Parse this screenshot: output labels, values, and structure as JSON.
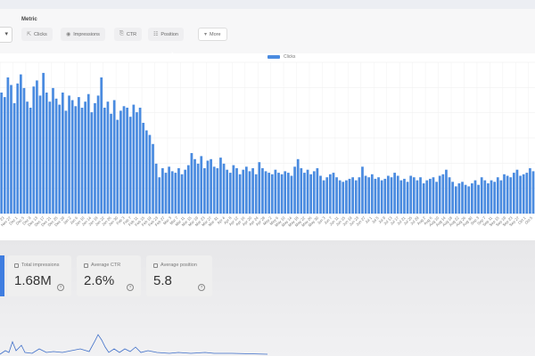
{
  "metric_section": {
    "title": "Metric",
    "chips": [
      {
        "icon": "cursor-click-icon",
        "label": "Clicks"
      },
      {
        "icon": "eye-icon",
        "label": "Impressions"
      },
      {
        "icon": "ctr-icon",
        "label": "CTR"
      },
      {
        "icon": "position-icon",
        "label": "Position"
      },
      {
        "icon": "chevron-down-icon",
        "label": "More"
      }
    ]
  },
  "chart": {
    "legend_label": "Clicks",
    "bar_color": "#4a8be0"
  },
  "chart_data": {
    "type": "bar",
    "x_ticks": [
      "Nov 23",
      "Nov 27",
      "Dec 1",
      "Dec 5",
      "Dec 9",
      "Dec 13",
      "Dec 17",
      "Dec 21",
      "Dec 25",
      "Dec 29",
      "Jan 2",
      "Jan 6",
      "Jan 10",
      "Jan 14",
      "Jan 18",
      "Jan 22",
      "Jan 26",
      "Jan 30",
      "Feb 3",
      "Feb 7",
      "Feb 11",
      "Feb 15",
      "Feb 19",
      "Feb 23",
      "Feb 27",
      "Mar 3",
      "Mar 7",
      "Mar 11",
      "Mar 15",
      "Mar 19",
      "Mar 23",
      "Mar 27",
      "Mar 31",
      "Apr 4",
      "Apr 8",
      "Apr 12",
      "Apr 16",
      "Apr 20",
      "Apr 24",
      "Apr 28",
      "May 2",
      "May 6",
      "May 10",
      "May 14",
      "May 18",
      "May 22",
      "May 26",
      "May 30",
      "Jun 3",
      "Jun 7",
      "Jun 11",
      "Jun 15",
      "Jun 19",
      "Jun 23",
      "Jun 27",
      "Jul 1",
      "Jul 5",
      "Jul 9",
      "Jul 13",
      "Jul 17",
      "Jul 21",
      "Jul 25",
      "Jul 29",
      "Aug 2",
      "Aug 6",
      "Aug 10",
      "Aug 14",
      "Aug 18",
      "Aug 22",
      "Aug 26",
      "Aug 30",
      "Sep 3",
      "Sep 7",
      "Sep 11",
      "Sep 15",
      "Sep 19",
      "Sep 23",
      "Sep 27",
      "Oct 1",
      "Oct 5"
    ],
    "series": [
      {
        "name": "Clicks",
        "values": [
          0.8,
          0.77,
          0.9,
          0.85,
          0.73,
          0.86,
          0.92,
          0.83,
          0.74,
          0.7,
          0.84,
          0.88,
          0.78,
          0.93,
          0.8,
          0.74,
          0.83,
          0.76,
          0.72,
          0.8,
          0.68,
          0.78,
          0.75,
          0.71,
          0.77,
          0.7,
          0.74,
          0.79,
          0.67,
          0.73,
          0.78,
          0.9,
          0.7,
          0.74,
          0.66,
          0.75,
          0.62,
          0.68,
          0.71,
          0.7,
          0.64,
          0.72,
          0.67,
          0.7,
          0.6,
          0.55,
          0.52,
          0.46,
          0.33,
          0.24,
          0.3,
          0.27,
          0.31,
          0.28,
          0.27,
          0.3,
          0.26,
          0.29,
          0.32,
          0.4,
          0.36,
          0.33,
          0.38,
          0.3,
          0.35,
          0.36,
          0.31,
          0.3,
          0.37,
          0.33,
          0.29,
          0.27,
          0.32,
          0.3,
          0.26,
          0.29,
          0.31,
          0.28,
          0.3,
          0.26,
          0.34,
          0.3,
          0.28,
          0.27,
          0.26,
          0.29,
          0.27,
          0.26,
          0.28,
          0.27,
          0.25,
          0.31,
          0.36,
          0.3,
          0.27,
          0.29,
          0.26,
          0.28,
          0.3,
          0.25,
          0.22,
          0.24,
          0.26,
          0.27,
          0.24,
          0.22,
          0.21,
          0.22,
          0.23,
          0.24,
          0.22,
          0.24,
          0.31,
          0.25,
          0.24,
          0.26,
          0.23,
          0.24,
          0.22,
          0.23,
          0.25,
          0.24,
          0.27,
          0.25,
          0.22,
          0.23,
          0.21,
          0.25,
          0.24,
          0.22,
          0.24,
          0.2,
          0.22,
          0.23,
          0.24,
          0.21,
          0.25,
          0.26,
          0.29,
          0.24,
          0.21,
          0.18,
          0.2,
          0.21,
          0.19,
          0.18,
          0.2,
          0.22,
          0.19,
          0.24,
          0.22,
          0.2,
          0.22,
          0.21,
          0.24,
          0.22,
          0.26,
          0.25,
          0.24,
          0.27,
          0.29,
          0.25,
          0.26,
          0.27,
          0.3,
          0.28
        ]
      }
    ],
    "y_scale": "relative (no y-axis labels visible)",
    "grid": true,
    "legend_position": "top-center"
  },
  "cards": [
    {
      "label": "Total impressions",
      "value": "1.68M"
    },
    {
      "label": "Average CTR",
      "value": "2.6%"
    },
    {
      "label": "Average position",
      "value": "5.8"
    }
  ],
  "help_icon": "?"
}
